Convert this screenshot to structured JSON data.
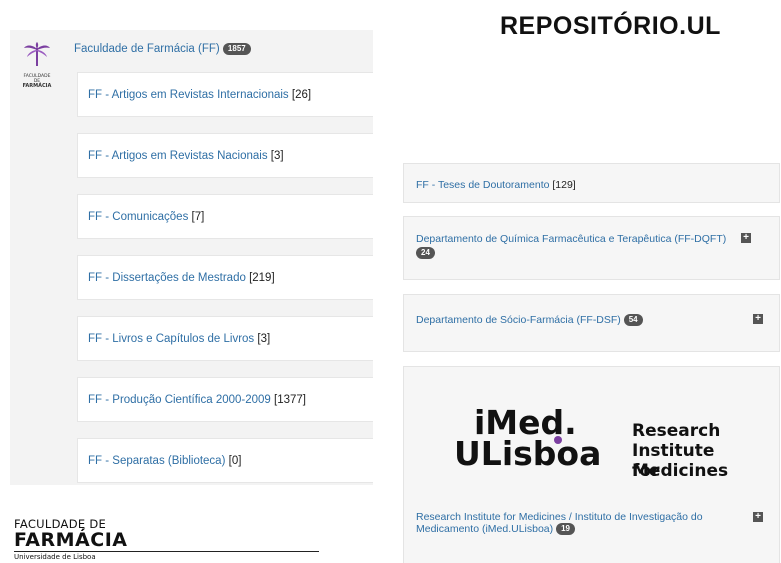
{
  "title": "REPOSITÓRIO.UL",
  "left": {
    "root_label": "Faculdade de Farmácia (FF)",
    "root_count": "1857",
    "logo_small_text": [
      "FACULDADE DE",
      "FARMÁCIA"
    ],
    "items": [
      {
        "label": "FF - Artigos em Revistas Internacionais",
        "count": "[26]"
      },
      {
        "label": "FF - Artigos em Revistas Nacionais",
        "count": "[3]"
      },
      {
        "label": "FF - Comunicações",
        "count": "[7]"
      },
      {
        "label": "FF - Dissertações de Mestrado",
        "count": "[219]"
      },
      {
        "label": "FF - Livros e Capítulos de Livros",
        "count": "[3]"
      },
      {
        "label": "FF - Produção Científica 2000-2009",
        "count": "[1377]"
      },
      {
        "label": "FF - Separatas (Biblioteca)",
        "count": "[0]"
      }
    ]
  },
  "right": {
    "items": [
      {
        "label": "FF - Teses de Doutoramento",
        "count": "[129]"
      },
      {
        "label": "Departamento de Química Farmacêutica e Terapêutica (FF-DQFT)",
        "badge": "24"
      },
      {
        "label": "Departamento de Sócio-Farmácia (FF-DSF)",
        "badge": "54"
      },
      {
        "label_line1": "Research Institute for Medicines / Instituto de Investigação do",
        "label_line2": "Medicamento (iMed.ULisboa)",
        "badge": "19"
      }
    ],
    "imed_logo": {
      "line1": "iMed.",
      "line2": "ULisboa",
      "tag1": "Research",
      "tag2": "Institute for",
      "tag3": "Medicines"
    }
  },
  "footer_logo": {
    "line1": "FACULDADE DE",
    "line2": "FARMÁCIA",
    "line3": "Universidade de Lisboa"
  },
  "colors": {
    "link": "#2f6fa5",
    "badge": "#555555",
    "imed_accent": "#7b3fa0"
  }
}
